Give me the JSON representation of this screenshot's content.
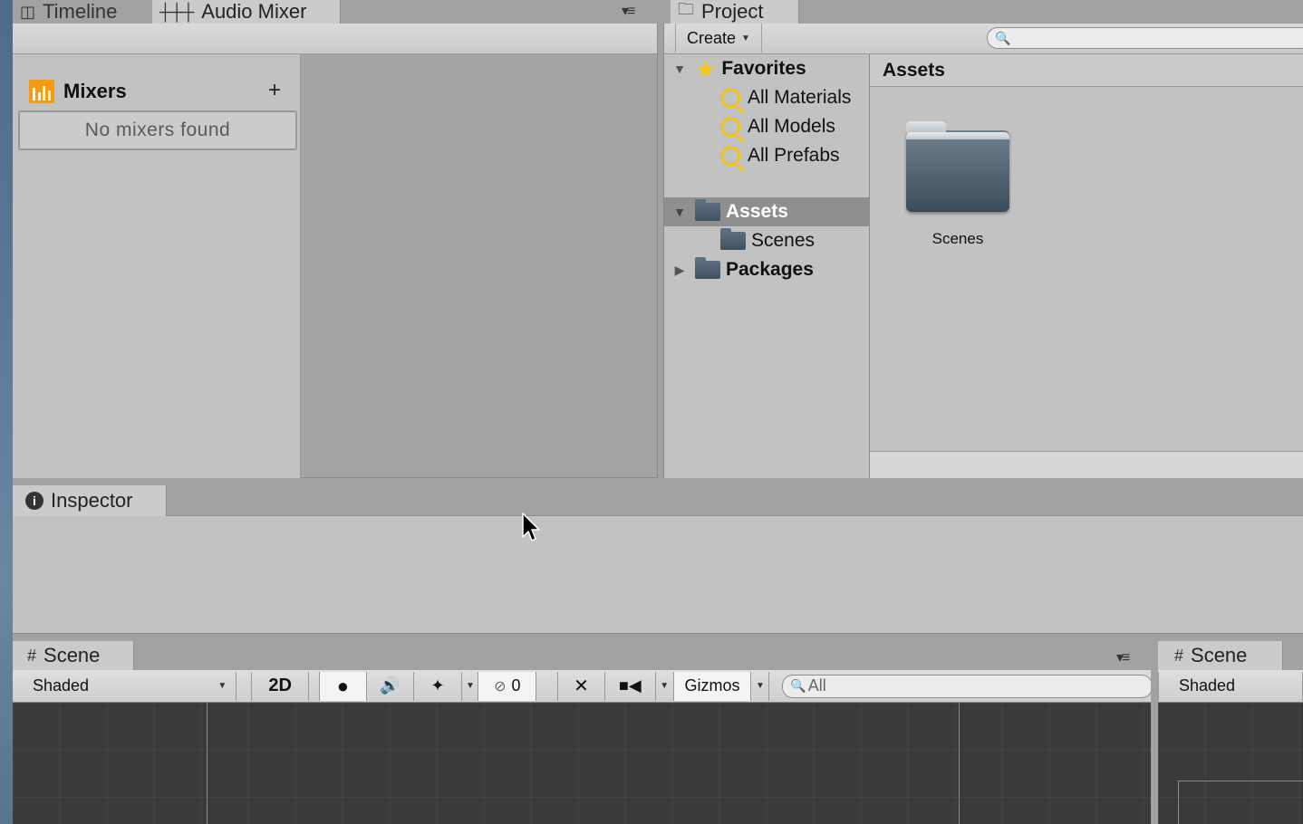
{
  "top_left_tabs": {
    "timeline": {
      "label": "Timeline",
      "icon": "timeline-icon"
    },
    "audio_mixer": {
      "label": "Audio Mixer",
      "icon": "mixer-sliders-icon"
    }
  },
  "mixers": {
    "title": "Mixers",
    "add_label": "+",
    "empty_message": "No mixers found"
  },
  "project": {
    "tab_label": "Project",
    "create_label": "Create",
    "search_placeholder": "",
    "favorites": {
      "label": "Favorites",
      "items": [
        "All Materials",
        "All Models",
        "All Prefabs"
      ]
    },
    "tree": {
      "assets": "Assets",
      "scenes": "Scenes",
      "packages": "Packages"
    },
    "breadcrumb": "Assets",
    "grid_items": [
      {
        "label": "Scenes",
        "icon": "folder-icon"
      }
    ]
  },
  "inspector": {
    "tab_label": "Inspector"
  },
  "scene": {
    "tab_label": "Scene",
    "shading_mode": "Shaded",
    "mode_2d": "2D",
    "hidden_count": "0",
    "gizmos_label": "Gizmos",
    "search_placeholder": "All"
  },
  "scene2": {
    "tab_label": "Scene",
    "shading_mode": "Shaded"
  },
  "colors": {
    "panel_bg": "#c2c2c2",
    "selection": "#8f8f8f",
    "viewport": "#3a3a3a",
    "mixer_accent": "#f39c12",
    "favorites_star": "#f5c518"
  }
}
